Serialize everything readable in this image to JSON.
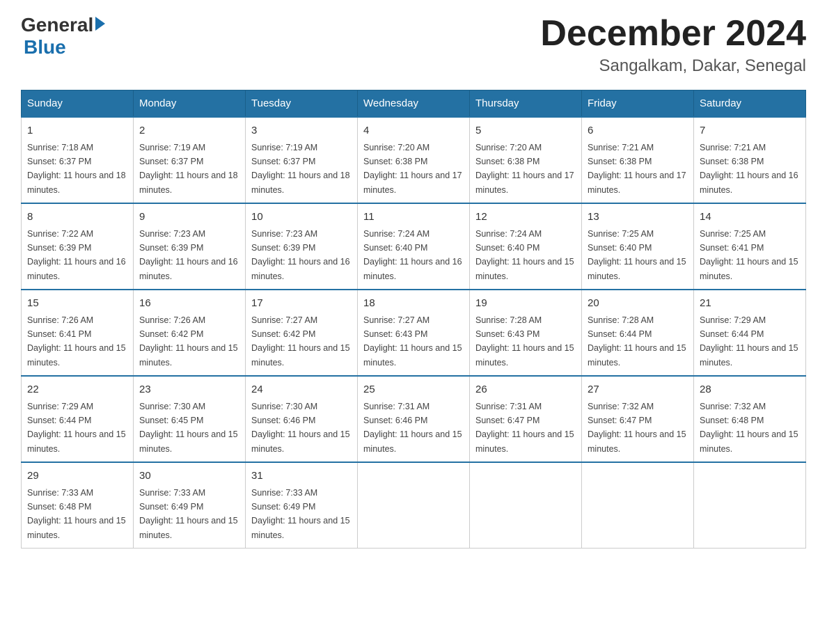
{
  "header": {
    "logo_general": "General",
    "logo_blue": "Blue",
    "month_title": "December 2024",
    "location": "Sangalkam, Dakar, Senegal"
  },
  "days_of_week": [
    "Sunday",
    "Monday",
    "Tuesday",
    "Wednesday",
    "Thursday",
    "Friday",
    "Saturday"
  ],
  "weeks": [
    [
      {
        "day": "1",
        "sunrise": "7:18 AM",
        "sunset": "6:37 PM",
        "daylight": "11 hours and 18 minutes."
      },
      {
        "day": "2",
        "sunrise": "7:19 AM",
        "sunset": "6:37 PM",
        "daylight": "11 hours and 18 minutes."
      },
      {
        "day": "3",
        "sunrise": "7:19 AM",
        "sunset": "6:37 PM",
        "daylight": "11 hours and 18 minutes."
      },
      {
        "day": "4",
        "sunrise": "7:20 AM",
        "sunset": "6:38 PM",
        "daylight": "11 hours and 17 minutes."
      },
      {
        "day": "5",
        "sunrise": "7:20 AM",
        "sunset": "6:38 PM",
        "daylight": "11 hours and 17 minutes."
      },
      {
        "day": "6",
        "sunrise": "7:21 AM",
        "sunset": "6:38 PM",
        "daylight": "11 hours and 17 minutes."
      },
      {
        "day": "7",
        "sunrise": "7:21 AM",
        "sunset": "6:38 PM",
        "daylight": "11 hours and 16 minutes."
      }
    ],
    [
      {
        "day": "8",
        "sunrise": "7:22 AM",
        "sunset": "6:39 PM",
        "daylight": "11 hours and 16 minutes."
      },
      {
        "day": "9",
        "sunrise": "7:23 AM",
        "sunset": "6:39 PM",
        "daylight": "11 hours and 16 minutes."
      },
      {
        "day": "10",
        "sunrise": "7:23 AM",
        "sunset": "6:39 PM",
        "daylight": "11 hours and 16 minutes."
      },
      {
        "day": "11",
        "sunrise": "7:24 AM",
        "sunset": "6:40 PM",
        "daylight": "11 hours and 16 minutes."
      },
      {
        "day": "12",
        "sunrise": "7:24 AM",
        "sunset": "6:40 PM",
        "daylight": "11 hours and 15 minutes."
      },
      {
        "day": "13",
        "sunrise": "7:25 AM",
        "sunset": "6:40 PM",
        "daylight": "11 hours and 15 minutes."
      },
      {
        "day": "14",
        "sunrise": "7:25 AM",
        "sunset": "6:41 PM",
        "daylight": "11 hours and 15 minutes."
      }
    ],
    [
      {
        "day": "15",
        "sunrise": "7:26 AM",
        "sunset": "6:41 PM",
        "daylight": "11 hours and 15 minutes."
      },
      {
        "day": "16",
        "sunrise": "7:26 AM",
        "sunset": "6:42 PM",
        "daylight": "11 hours and 15 minutes."
      },
      {
        "day": "17",
        "sunrise": "7:27 AM",
        "sunset": "6:42 PM",
        "daylight": "11 hours and 15 minutes."
      },
      {
        "day": "18",
        "sunrise": "7:27 AM",
        "sunset": "6:43 PM",
        "daylight": "11 hours and 15 minutes."
      },
      {
        "day": "19",
        "sunrise": "7:28 AM",
        "sunset": "6:43 PM",
        "daylight": "11 hours and 15 minutes."
      },
      {
        "day": "20",
        "sunrise": "7:28 AM",
        "sunset": "6:44 PM",
        "daylight": "11 hours and 15 minutes."
      },
      {
        "day": "21",
        "sunrise": "7:29 AM",
        "sunset": "6:44 PM",
        "daylight": "11 hours and 15 minutes."
      }
    ],
    [
      {
        "day": "22",
        "sunrise": "7:29 AM",
        "sunset": "6:44 PM",
        "daylight": "11 hours and 15 minutes."
      },
      {
        "day": "23",
        "sunrise": "7:30 AM",
        "sunset": "6:45 PM",
        "daylight": "11 hours and 15 minutes."
      },
      {
        "day": "24",
        "sunrise": "7:30 AM",
        "sunset": "6:46 PM",
        "daylight": "11 hours and 15 minutes."
      },
      {
        "day": "25",
        "sunrise": "7:31 AM",
        "sunset": "6:46 PM",
        "daylight": "11 hours and 15 minutes."
      },
      {
        "day": "26",
        "sunrise": "7:31 AM",
        "sunset": "6:47 PM",
        "daylight": "11 hours and 15 minutes."
      },
      {
        "day": "27",
        "sunrise": "7:32 AM",
        "sunset": "6:47 PM",
        "daylight": "11 hours and 15 minutes."
      },
      {
        "day": "28",
        "sunrise": "7:32 AM",
        "sunset": "6:48 PM",
        "daylight": "11 hours and 15 minutes."
      }
    ],
    [
      {
        "day": "29",
        "sunrise": "7:33 AM",
        "sunset": "6:48 PM",
        "daylight": "11 hours and 15 minutes."
      },
      {
        "day": "30",
        "sunrise": "7:33 AM",
        "sunset": "6:49 PM",
        "daylight": "11 hours and 15 minutes."
      },
      {
        "day": "31",
        "sunrise": "7:33 AM",
        "sunset": "6:49 PM",
        "daylight": "11 hours and 15 minutes."
      },
      null,
      null,
      null,
      null
    ]
  ]
}
